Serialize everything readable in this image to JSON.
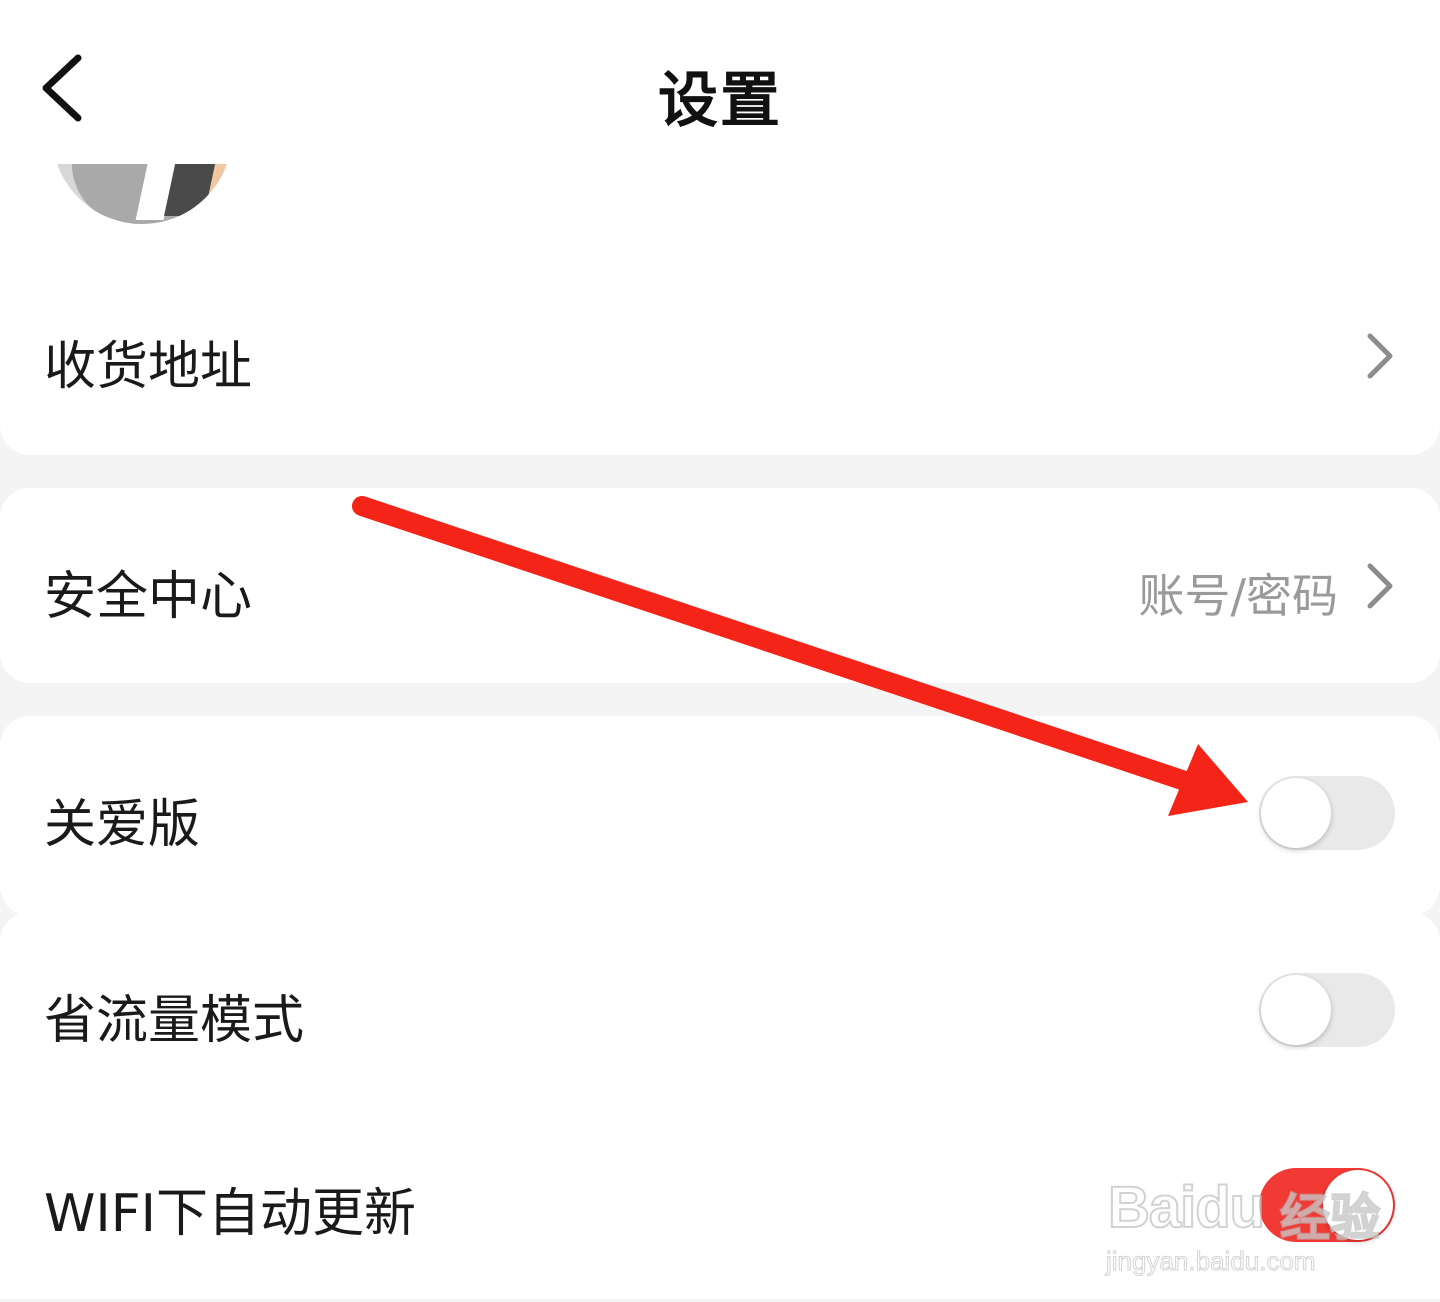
{
  "header": {
    "title": "设置",
    "back_icon": "chevron-left-icon"
  },
  "rows": {
    "address": {
      "label": "收货地址"
    },
    "security": {
      "label": "安全中心",
      "value": "账号/密码"
    },
    "care_mode": {
      "label": "关爱版",
      "toggle": false
    },
    "data_saver": {
      "label": "省流量模式",
      "toggle": false
    },
    "wifi_update": {
      "label": "WIFI下自动更新",
      "toggle": true
    }
  },
  "colors": {
    "accent": "#f23a35",
    "annotation_arrow": "#f42418",
    "toggle_off": "#e9e9e9",
    "background": "#f4f4f4"
  },
  "watermark": {
    "logo": "Baidu",
    "cn": "经验",
    "url": "jingyan.baidu.com"
  }
}
